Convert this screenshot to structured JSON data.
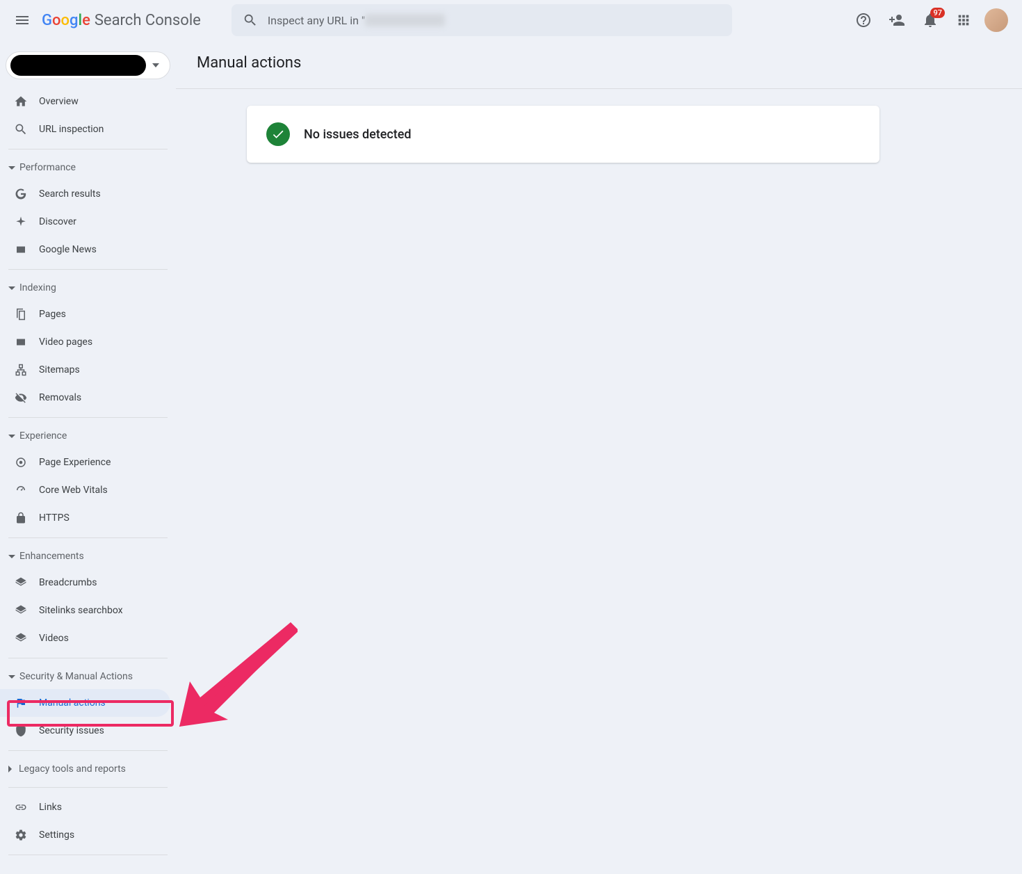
{
  "header": {
    "product_name": "Search Console",
    "search_prefix": "Inspect any URL in \"",
    "notifications_count": "97"
  },
  "sidebar": {
    "overview": "Overview",
    "url_inspection": "URL inspection",
    "sections": {
      "performance": {
        "label": "Performance",
        "items": [
          "Search results",
          "Discover",
          "Google News"
        ]
      },
      "indexing": {
        "label": "Indexing",
        "items": [
          "Pages",
          "Video pages",
          "Sitemaps",
          "Removals"
        ]
      },
      "experience": {
        "label": "Experience",
        "items": [
          "Page Experience",
          "Core Web Vitals",
          "HTTPS"
        ]
      },
      "enhancements": {
        "label": "Enhancements",
        "items": [
          "Breadcrumbs",
          "Sitelinks searchbox",
          "Videos"
        ]
      },
      "security": {
        "label": "Security & Manual Actions",
        "items": [
          "Manual actions",
          "Security issues"
        ]
      },
      "legacy": {
        "label": "Legacy tools and reports"
      }
    },
    "links": "Links",
    "settings": "Settings"
  },
  "main": {
    "page_title": "Manual actions",
    "status_message": "No issues detected"
  }
}
